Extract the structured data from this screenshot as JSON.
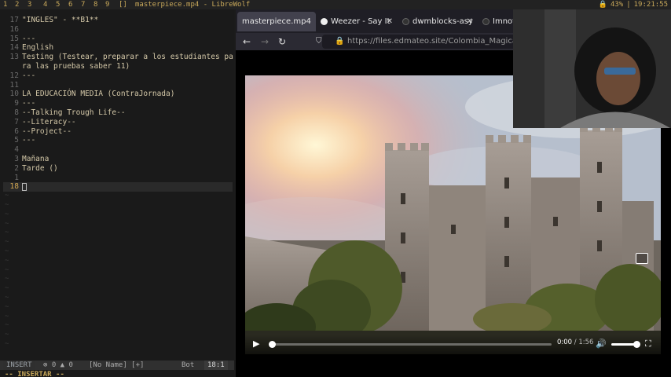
{
  "topbar": {
    "tags": [
      "1",
      "2",
      "3",
      "4",
      "5",
      "6",
      "7",
      "8",
      "9",
      "[]"
    ],
    "window_title": "masterpiece.mp4 - LibreWolf",
    "battery": "43%",
    "time": "19:21:55"
  },
  "editor": {
    "lines": [
      {
        "num": "17",
        "text": "\"INGLES\" - **B1**"
      },
      {
        "num": "16",
        "text": ""
      },
      {
        "num": "15",
        "text": "---"
      },
      {
        "num": "14",
        "text": "English"
      },
      {
        "num": "13",
        "text": "Testing (Testear, preparar a los estudiantes pa"
      },
      {
        "num": "",
        "text": "ra las pruebas saber 11)"
      },
      {
        "num": "12",
        "text": "---"
      },
      {
        "num": "11",
        "text": ""
      },
      {
        "num": "10",
        "text": "LA EDUCACIÓN MEDIA (ContraJornada)"
      },
      {
        "num": "9",
        "text": "---"
      },
      {
        "num": "8",
        "text": "--Talking Trough Life--"
      },
      {
        "num": "7",
        "text": "--Literacy--"
      },
      {
        "num": "6",
        "text": "--Project--"
      },
      {
        "num": "5",
        "text": "---"
      },
      {
        "num": "4",
        "text": ""
      },
      {
        "num": "3",
        "text": "Mañana"
      },
      {
        "num": "2",
        "text": "Tarde ()"
      },
      {
        "num": "1",
        "text": ""
      }
    ],
    "current_line": {
      "num": "18",
      "text": ""
    },
    "status": {
      "mode": "INSERT",
      "diagnostics": "⊗ 0 ▲ 0",
      "filename": "[No Name] [+]",
      "position": "Bot",
      "line_col": "18:1"
    },
    "cmdline": "-- INSERTAR --"
  },
  "browser": {
    "tabs": [
      {
        "label": "masterpiece.mp4",
        "active": true
      },
      {
        "label": "Weezer - Say It",
        "active": false
      },
      {
        "label": "dwmblocks-asy",
        "active": false
      },
      {
        "label": "ImnotE",
        "active": false
      }
    ],
    "url": "https://files.edmateo.site/Colombia_Magica/SanJ",
    "video": {
      "current_time": "0:00",
      "duration": "/ 1:56",
      "progress": 0.0,
      "volume": 1.0
    }
  }
}
